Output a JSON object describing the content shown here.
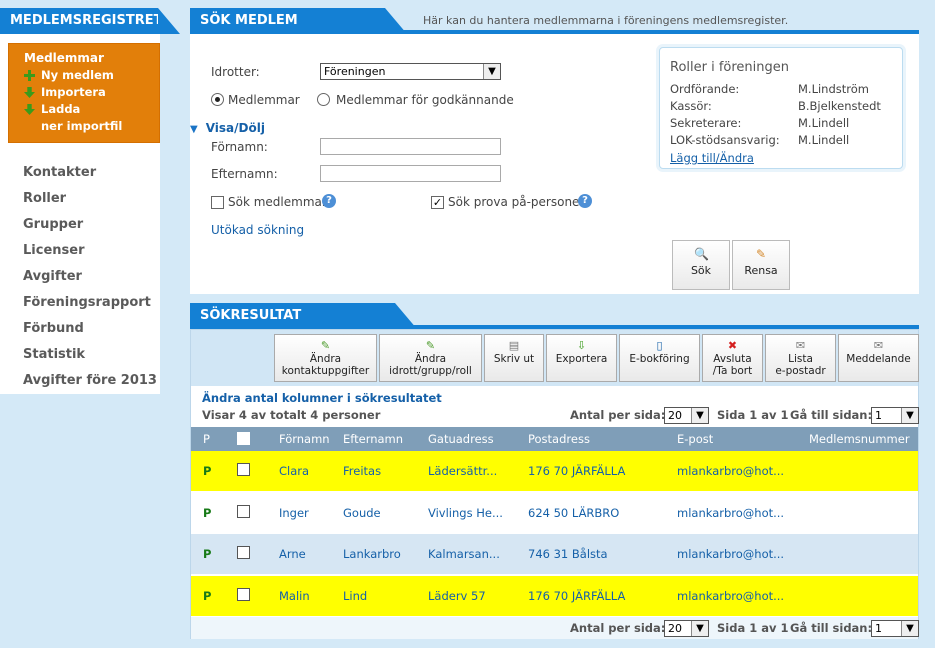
{
  "header": {
    "left_tab": "MEDLEMSREGISTRET",
    "search_tab": "SÖK MEDLEM",
    "description": "Här kan du hantera medlemmarna i föreningens medlemsregister."
  },
  "sidebar": {
    "active": {
      "title": "Medlemmar",
      "items": [
        "Ny medlem",
        "Importera",
        "Ladda",
        "ner importfil"
      ]
    },
    "items": [
      "Kontakter",
      "Roller",
      "Grupper",
      "Licenser",
      "Avgifter",
      "Föreningsrapport",
      "Förbund",
      "Statistik",
      "Avgifter före 2013"
    ]
  },
  "search": {
    "sport_label": "Idrotter:",
    "sport_value": "Föreningen",
    "radio_members": "Medlemmar",
    "radio_pending": "Medlemmar för godkännande",
    "toggle": "Visa/Dölj",
    "firstname_label": "Förnamn:",
    "lastname_label": "Efternamn:",
    "firstname_value": "",
    "lastname_value": "",
    "chk_members": "Sök medlemmar",
    "chk_trial": "Sök prova på-personer",
    "extended": "Utökad sökning",
    "btn_search": "Sök",
    "btn_clear": "Rensa"
  },
  "roles": {
    "title": "Roller i föreningen",
    "entries": [
      {
        "role": "Ordförande:",
        "name": "M.Lindström"
      },
      {
        "role": "Kassör:",
        "name": "B.Bjelkenstedt"
      },
      {
        "role": "Sekreterare:",
        "name": "M.Lindell"
      },
      {
        "role": "LOK-stödsansvarig:",
        "name": "M.Lindell"
      }
    ],
    "link": "Lägg till/Ändra"
  },
  "results": {
    "tab": "SÖKRESULTAT",
    "toolbar": [
      {
        "line1": "Ändra",
        "line2": "kontaktuppgifter",
        "icon": "pencil-icon"
      },
      {
        "line1": "Ändra",
        "line2": "idrott/grupp/roll",
        "icon": "pencil-icon"
      },
      {
        "line1": "Skriv ut",
        "line2": "",
        "icon": "printer-icon"
      },
      {
        "line1": "Exportera",
        "line2": "",
        "icon": "export-icon"
      },
      {
        "line1": "E-bokföring",
        "line2": "",
        "icon": "book-icon"
      },
      {
        "line1": "Avsluta",
        "line2": "/Ta bort",
        "icon": "delete-icon"
      },
      {
        "line1": "Lista",
        "line2": "e-postadr",
        "icon": "mail-icon"
      },
      {
        "line1": "Meddelande",
        "line2": "",
        "icon": "mail-icon"
      }
    ],
    "change_columns": "Ändra antal kolumner i sökresultatet",
    "showing": "Visar 4 av totalt 4 personer",
    "per_page_label": "Antal per sida:",
    "per_page": "20",
    "page_label": "Sida 1 av 1",
    "goto_label": "Gå till sidan:",
    "goto": "1",
    "columns": [
      "P",
      "Förnamn",
      "Efternamn",
      "Gatuadress",
      "Postadress",
      "E-post",
      "Medlemsnummer"
    ],
    "rows": [
      {
        "p": "P",
        "first": "Clara",
        "last": "Freitas",
        "street": "Lädersättr...",
        "post": "176 70 JÄRFÄLLA",
        "email": "mlankarbro@hot...",
        "color": "#ffff00"
      },
      {
        "p": "P",
        "first": "Inger",
        "last": "Goude",
        "street": "Vivlings He...",
        "post": "624 50 LÄRBRO",
        "email": "mlankarbro@hot...",
        "color": "#ffffff"
      },
      {
        "p": "P",
        "first": "Arne",
        "last": "Lankarbro",
        "street": "Kalmarsan...",
        "post": "746 31 Bålsta",
        "email": "mlankarbro@hot...",
        "color": "#d6e6f3"
      },
      {
        "p": "P",
        "first": "Malin",
        "last": "Lind",
        "street": "Läderv 57",
        "post": "176 70 JÄRFÄLLA",
        "email": "mlankarbro@hot...",
        "color": "#ffff00"
      }
    ]
  }
}
